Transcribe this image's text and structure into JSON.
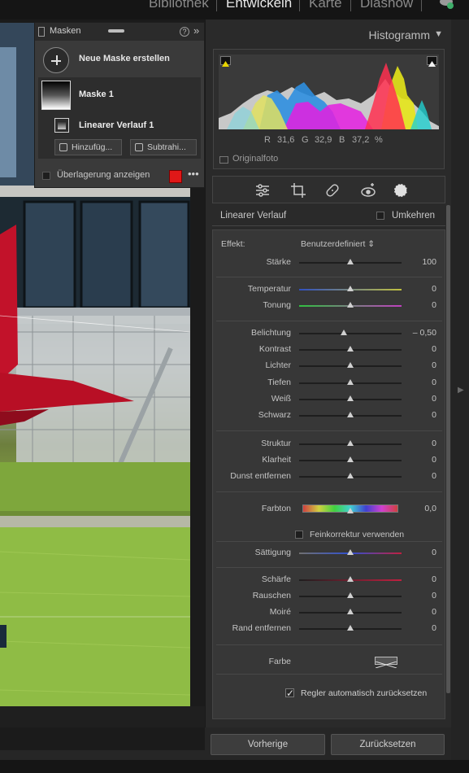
{
  "modules": [
    "Bibliothek",
    "Entwickeln",
    "Karte",
    "Diashow"
  ],
  "masks_panel": {
    "title": "Masken",
    "help_icon": "?",
    "collapse_icon": "»",
    "new_mask_label": "Neue Maske erstellen",
    "mask_name": "Maske 1",
    "component_name": "Linearer Verlauf 1",
    "add_label": "Hinzufüg...",
    "subtract_label": "Subtrahi...",
    "overlay_label": "Überlagerung anzeigen",
    "overlay_color": "#e01818",
    "more_icon": "•••"
  },
  "histogram": {
    "title": "Histogramm",
    "r_label": "R",
    "r_value": "31,6",
    "g_label": "G",
    "g_value": "32,9",
    "b_label": "B",
    "b_value": "37,2",
    "unit": "%",
    "original_photo_label": "Originalfoto"
  },
  "tools": [
    "adjust-icon",
    "crop-icon",
    "heal-icon",
    "redeye-icon",
    "mask-icon"
  ],
  "mask_edit": {
    "title": "Linearer Verlauf",
    "invert_label": "Umkehren",
    "effect_label": "Effekt:",
    "effect_value": "Benutzerdefiniert ⇕",
    "sliders": [
      {
        "label": "Stärke",
        "value": "100",
        "pos": 0.5,
        "track": "plain"
      },
      {
        "label": "Temperatur",
        "value": "0",
        "pos": 0.5,
        "track": "temp"
      },
      {
        "label": "Tonung",
        "value": "0",
        "pos": 0.5,
        "track": "tint"
      },
      {
        "label": "Belichtung",
        "value": "– 0,50",
        "pos": 0.44,
        "track": "plain"
      },
      {
        "label": "Kontrast",
        "value": "0",
        "pos": 0.5,
        "track": "plain"
      },
      {
        "label": "Lichter",
        "value": "0",
        "pos": 0.5,
        "track": "plain"
      },
      {
        "label": "Tiefen",
        "value": "0",
        "pos": 0.5,
        "track": "plain"
      },
      {
        "label": "Weiß",
        "value": "0",
        "pos": 0.5,
        "track": "plain"
      },
      {
        "label": "Schwarz",
        "value": "0",
        "pos": 0.5,
        "track": "plain"
      },
      {
        "label": "Struktur",
        "value": "0",
        "pos": 0.5,
        "track": "plain"
      },
      {
        "label": "Klarheit",
        "value": "0",
        "pos": 0.5,
        "track": "plain"
      },
      {
        "label": "Dunst entfernen",
        "value": "0",
        "pos": 0.5,
        "track": "plain"
      },
      {
        "label": "Farbton",
        "value": "0,0",
        "pos": 0.5,
        "track": "hue"
      },
      {
        "label": "Sättigung",
        "value": "0",
        "pos": 0.5,
        "track": "sat"
      },
      {
        "label": "Schärfe",
        "value": "0",
        "pos": 0.5,
        "track": "sharp"
      },
      {
        "label": "Rauschen",
        "value": "0",
        "pos": 0.5,
        "track": "plain"
      },
      {
        "label": "Moiré",
        "value": "0",
        "pos": 0.5,
        "track": "plain"
      },
      {
        "label": "Rand entfernen",
        "value": "0",
        "pos": 0.5,
        "track": "plain"
      }
    ],
    "fine_adjust_label": "Feinkorrektur verwenden",
    "color_label": "Farbe",
    "auto_reset_label": "Regler automatisch zurücksetzen",
    "auto_reset_checked": true
  },
  "buttons": {
    "previous": "Vorherige",
    "reset": "Zurücksetzen"
  }
}
